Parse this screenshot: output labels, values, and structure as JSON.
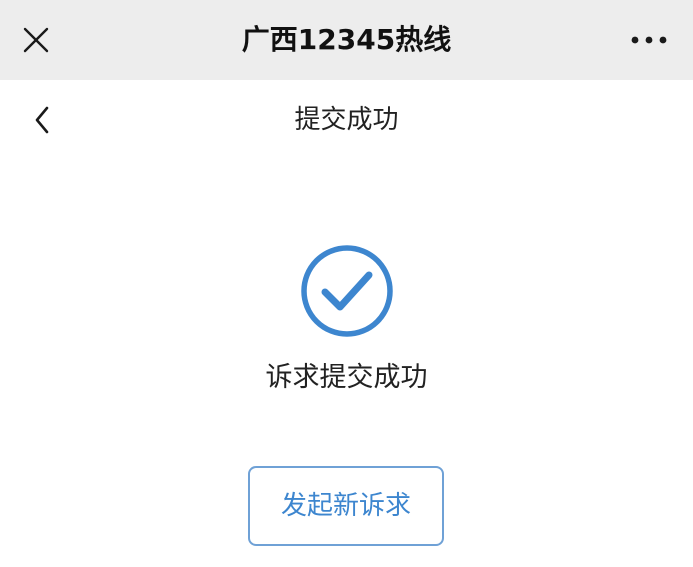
{
  "top_bar": {
    "title": "广西12345热线",
    "close_icon": "close-icon",
    "more_icon": "more-horizontal-icon"
  },
  "nav_bar": {
    "title": "提交成功",
    "back_icon": "chevron-left-icon"
  },
  "result": {
    "icon": "check-circle-icon",
    "message": "诉求提交成功",
    "accent_color": "#3d86cf"
  },
  "actions": {
    "new_request_label": "发起新诉求"
  }
}
